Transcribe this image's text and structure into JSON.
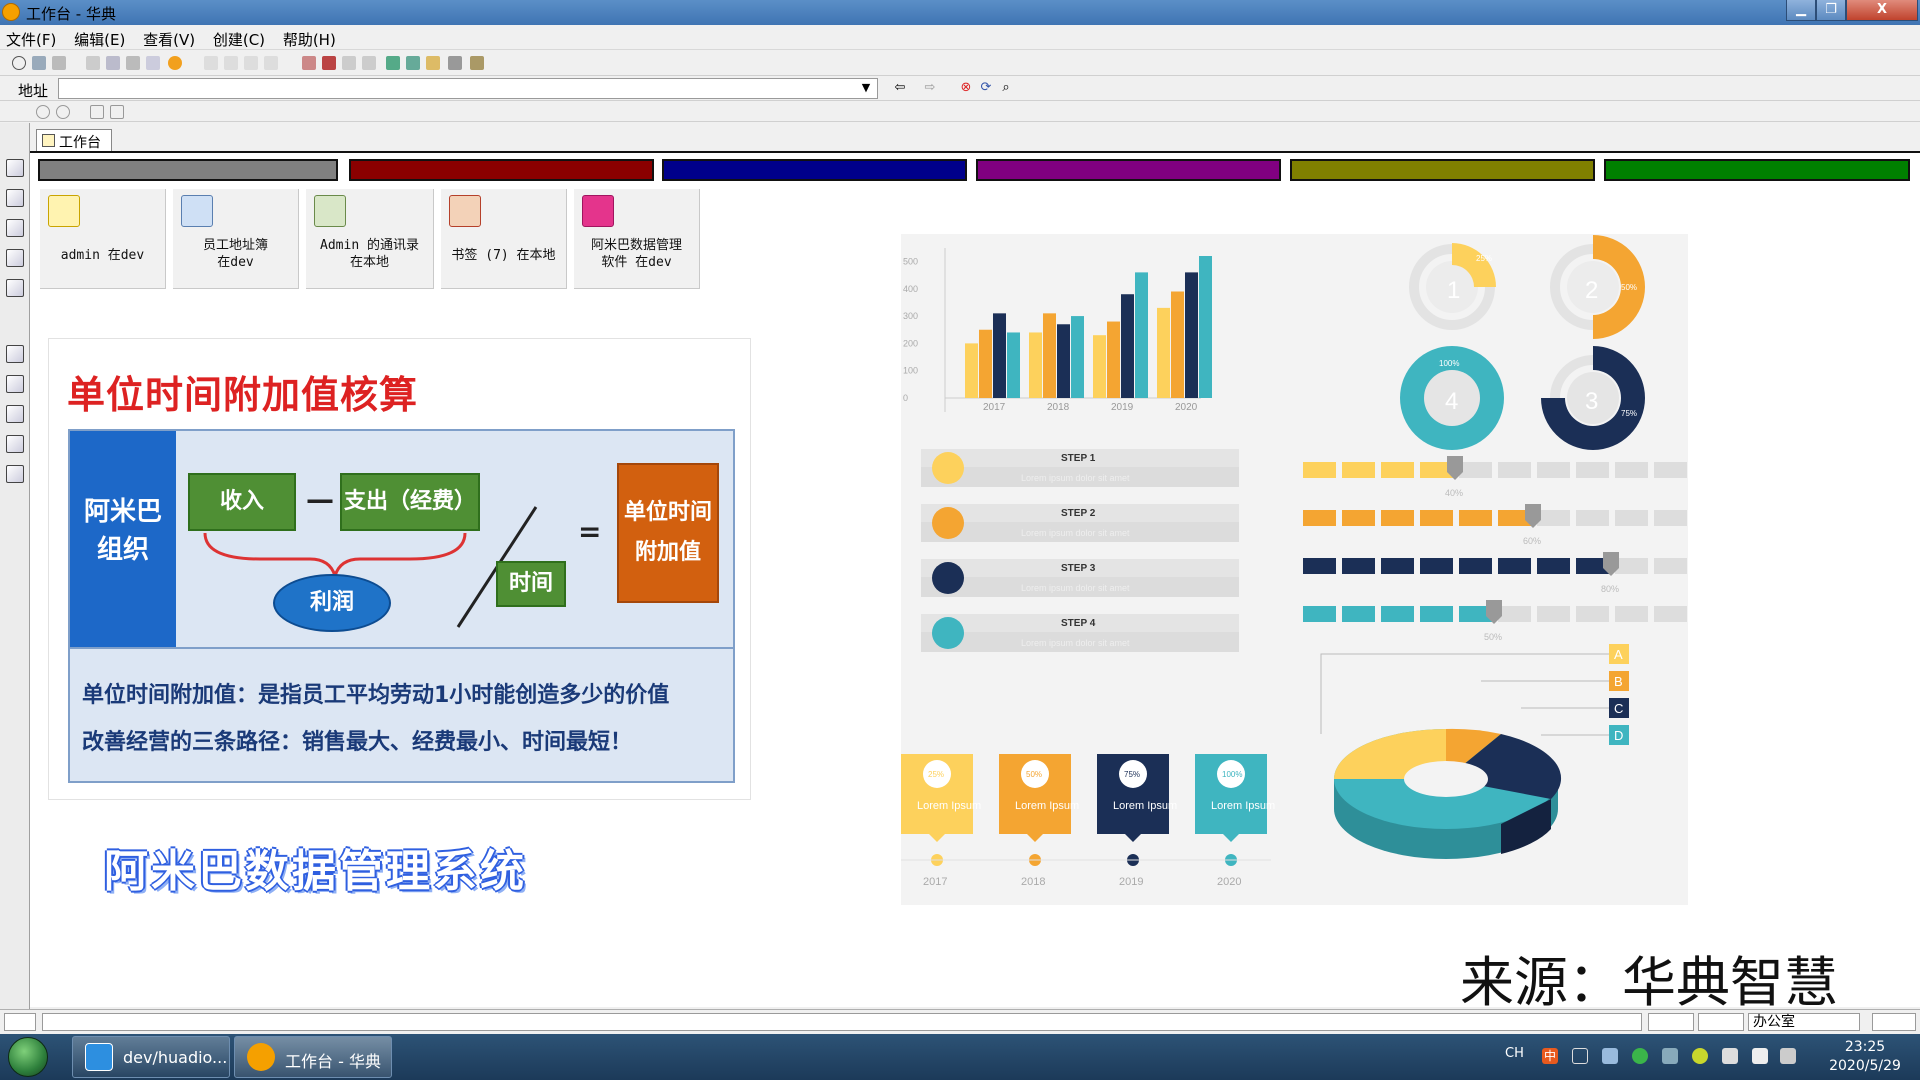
{
  "window": {
    "title": "工作台 - 华典",
    "min_glyph": "▁",
    "max_glyph": "❐",
    "close_glyph": "X"
  },
  "menu": [
    "文件(F)",
    "编辑(E)",
    "查看(V)",
    "创建(C)",
    "帮助(H)"
  ],
  "address": {
    "label": "地址",
    "value": "",
    "dropdown_glyph": "▼"
  },
  "tab": {
    "label": "工作台"
  },
  "color_bands": [
    "#808080",
    "#8b0000",
    "#00008b",
    "#800080",
    "#808000",
    "#008000"
  ],
  "tiles": [
    {
      "icon": "folder-email-icon",
      "line1": "admin 在dev",
      "line2": ""
    },
    {
      "icon": "address-book-icon",
      "line1": "员工地址簿",
      "line2": "在dev"
    },
    {
      "icon": "contacts-book-icon",
      "line1": "Admin 的通讯录",
      "line2": "在本地"
    },
    {
      "icon": "bookmark-house-icon",
      "line1": "书签 (7) 在本地",
      "line2": ""
    },
    {
      "icon": "rss-feed-icon",
      "line1": "阿米巴数据管理",
      "line2": "软件 在dev"
    }
  ],
  "slide": {
    "title": "单位时间附加值核算",
    "org_line1": "阿米巴",
    "org_line2": "组织",
    "income": "收入",
    "minus": "—",
    "expense": "支出（经费）",
    "profit": "利润",
    "time": "时间",
    "equals": "=",
    "result_line1": "单位时间",
    "result_line2": "附加值",
    "line1": "单位时间附加值：是指员工平均劳动1小时能创造多少的价值",
    "line2": "改善经营的三条路径：销售最大、经费最小、时间最短！"
  },
  "brand_text": "阿米巴数据管理系统",
  "source_text": "来源：华典智慧",
  "infographic": {
    "colors": {
      "yellow": "#fdd15c",
      "orange": "#f4a532",
      "navy": "#1b2f56",
      "teal": "#3fb5c0",
      "gray": "#dddddd"
    },
    "bar_chart": {
      "y_ticks": [
        "500",
        "400",
        "300",
        "200",
        "100",
        "0"
      ],
      "years": [
        "2017",
        "2018",
        "2019",
        "2020"
      ],
      "series": [
        {
          "values": [
            200,
            240,
            230,
            330
          ]
        },
        {
          "values": [
            250,
            310,
            280,
            390
          ]
        },
        {
          "values": [
            310,
            270,
            380,
            460
          ]
        },
        {
          "values": [
            240,
            300,
            460,
            520
          ]
        }
      ]
    },
    "donuts": [
      {
        "number": "1",
        "percent": "25%"
      },
      {
        "number": "2",
        "percent": "50%"
      },
      {
        "number": "4",
        "percent": "100%"
      },
      {
        "number": "3",
        "percent": "75%"
      }
    ],
    "steps": [
      {
        "label": "STEP 1",
        "text": "Lorem ipsum dolor sit amet"
      },
      {
        "label": "STEP 2",
        "text": "Lorem ipsum dolor sit amet"
      },
      {
        "label": "STEP 3",
        "text": "Lorem ipsum dolor sit amet"
      },
      {
        "label": "STEP 4",
        "text": "Lorem ipsum dolor sit amet"
      }
    ],
    "progress": [
      {
        "label": "40%",
        "value": 0.4
      },
      {
        "label": "60%",
        "value": 0.6
      },
      {
        "label": "80%",
        "value": 0.8
      },
      {
        "label": "50%",
        "value": 0.5
      }
    ],
    "cards": [
      {
        "percent": "25%",
        "text": "Lorem Ipsum",
        "year": "2017"
      },
      {
        "percent": "50%",
        "text": "Lorem Ipsum",
        "year": "2018"
      },
      {
        "percent": "75%",
        "text": "Lorem Ipsum",
        "year": "2019"
      },
      {
        "percent": "100%",
        "text": "Lorem Ipsum",
        "year": "2020"
      }
    ],
    "pie_legend": [
      "A",
      "B",
      "C",
      "D"
    ]
  },
  "statusbar": {
    "office_select": "办公室"
  },
  "taskbar": {
    "buttons": [
      {
        "label": "dev/huadio..."
      },
      {
        "label": "工作台 - 华典"
      }
    ],
    "ime": "CH",
    "ime_mode": "中",
    "time": "23:25",
    "date": "2020/5/29"
  }
}
